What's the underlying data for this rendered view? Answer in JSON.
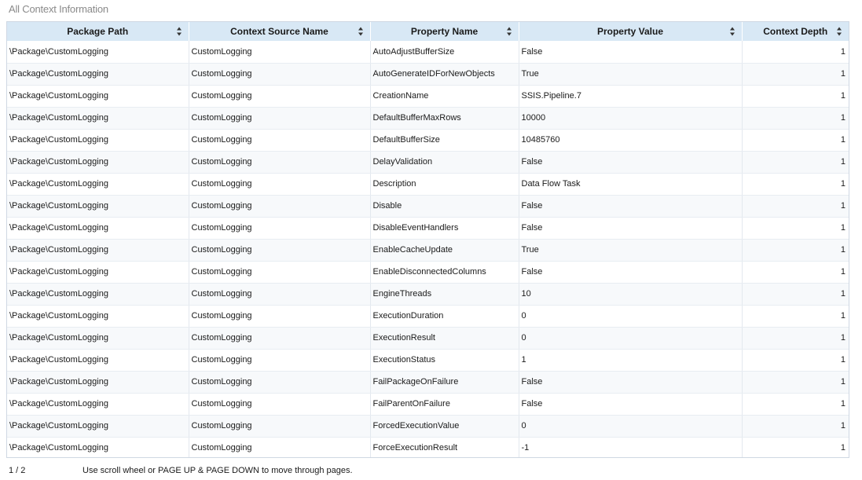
{
  "title": "All Context Information",
  "columns": [
    {
      "label": "Package Path"
    },
    {
      "label": "Context Source Name"
    },
    {
      "label": "Property Name"
    },
    {
      "label": "Property Value"
    },
    {
      "label": "Context Depth"
    }
  ],
  "rows": [
    [
      "\\Package\\CustomLogging",
      "CustomLogging",
      "AutoAdjustBufferSize",
      "False",
      "1"
    ],
    [
      "\\Package\\CustomLogging",
      "CustomLogging",
      "AutoGenerateIDForNewObjects",
      "True",
      "1"
    ],
    [
      "\\Package\\CustomLogging",
      "CustomLogging",
      "CreationName",
      "SSIS.Pipeline.7",
      "1"
    ],
    [
      "\\Package\\CustomLogging",
      "CustomLogging",
      "DefaultBufferMaxRows",
      "10000",
      "1"
    ],
    [
      "\\Package\\CustomLogging",
      "CustomLogging",
      "DefaultBufferSize",
      "10485760",
      "1"
    ],
    [
      "\\Package\\CustomLogging",
      "CustomLogging",
      "DelayValidation",
      "False",
      "1"
    ],
    [
      "\\Package\\CustomLogging",
      "CustomLogging",
      "Description",
      "Data Flow Task",
      "1"
    ],
    [
      "\\Package\\CustomLogging",
      "CustomLogging",
      "Disable",
      "False",
      "1"
    ],
    [
      "\\Package\\CustomLogging",
      "CustomLogging",
      "DisableEventHandlers",
      "False",
      "1"
    ],
    [
      "\\Package\\CustomLogging",
      "CustomLogging",
      "EnableCacheUpdate",
      "True",
      "1"
    ],
    [
      "\\Package\\CustomLogging",
      "CustomLogging",
      "EnableDisconnectedColumns",
      "False",
      "1"
    ],
    [
      "\\Package\\CustomLogging",
      "CustomLogging",
      "EngineThreads",
      "10",
      "1"
    ],
    [
      "\\Package\\CustomLogging",
      "CustomLogging",
      "ExecutionDuration",
      "0",
      "1"
    ],
    [
      "\\Package\\CustomLogging",
      "CustomLogging",
      "ExecutionResult",
      "0",
      "1"
    ],
    [
      "\\Package\\CustomLogging",
      "CustomLogging",
      "ExecutionStatus",
      "1",
      "1"
    ],
    [
      "\\Package\\CustomLogging",
      "CustomLogging",
      "FailPackageOnFailure",
      "False",
      "1"
    ],
    [
      "\\Package\\CustomLogging",
      "CustomLogging",
      "FailParentOnFailure",
      "False",
      "1"
    ],
    [
      "\\Package\\CustomLogging",
      "CustomLogging",
      "ForcedExecutionValue",
      "0",
      "1"
    ],
    [
      "\\Package\\CustomLogging",
      "CustomLogging",
      "ForceExecutionResult",
      "-1",
      "1"
    ]
  ],
  "footer": {
    "page": "1 / 2",
    "hint": "Use scroll wheel or PAGE UP & PAGE DOWN to move through pages."
  }
}
